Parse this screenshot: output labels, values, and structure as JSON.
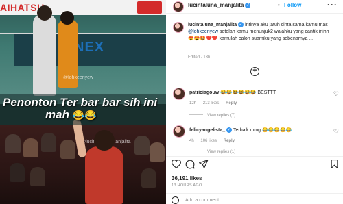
{
  "post": {
    "username": "lucintaluna_manjalita",
    "follow_label": "Follow",
    "dot": "•",
    "more_label": "···"
  },
  "media": {
    "brand_left": "AIHATSU",
    "board_text": "NEX",
    "watermark_top": "@lohkeenyew",
    "caption_line1": "Penonton Ter bar bar sih ini",
    "caption_line2": "mah",
    "caption_emoji": "😂😂",
    "watermark_bottom": "@lucintaluna_manjalita"
  },
  "caption": {
    "username": "lucintaluna_manjalita",
    "text_part1": "intinya aku jatuh cinta sama kamu mas",
    "mention": "@lohkeenyew",
    "text_part2": "setelah kamu menunjuk2 wajahku yang cantik inihh",
    "emojis": "😍😍🤩❤️❤️",
    "text_part3": "kamulah calon suamiku yang sebenarnya ...",
    "edited": "Edited · 13h"
  },
  "load_more_label": "+",
  "comments": [
    {
      "username": "patriciagouw",
      "text": "😂😂😂😂😂😂 BESTTT",
      "time": "12h",
      "likes": "213 likes",
      "reply": "Reply",
      "view_replies": "View replies (7)"
    },
    {
      "username": "felicyangelista_",
      "text": "Terbaik mmg 😂😂😂😂😂",
      "time": "4h",
      "likes": "106 likes",
      "reply": "Reply",
      "view_replies": "View replies (1)"
    }
  ],
  "stats": {
    "likes": "36,191 likes",
    "time": "13 HOURS AGO"
  },
  "add_comment": {
    "placeholder": "Add a comment..."
  },
  "icons": {
    "heart": "heart-icon",
    "comment": "comment-icon",
    "share": "share-icon",
    "bookmark": "bookmark-icon",
    "emoji": "emoji-icon",
    "verified": "verified-badge-icon"
  },
  "colors": {
    "accent": "#0095f6",
    "text": "#262626",
    "muted": "#8e8e8e",
    "verified": "#3897f0"
  }
}
